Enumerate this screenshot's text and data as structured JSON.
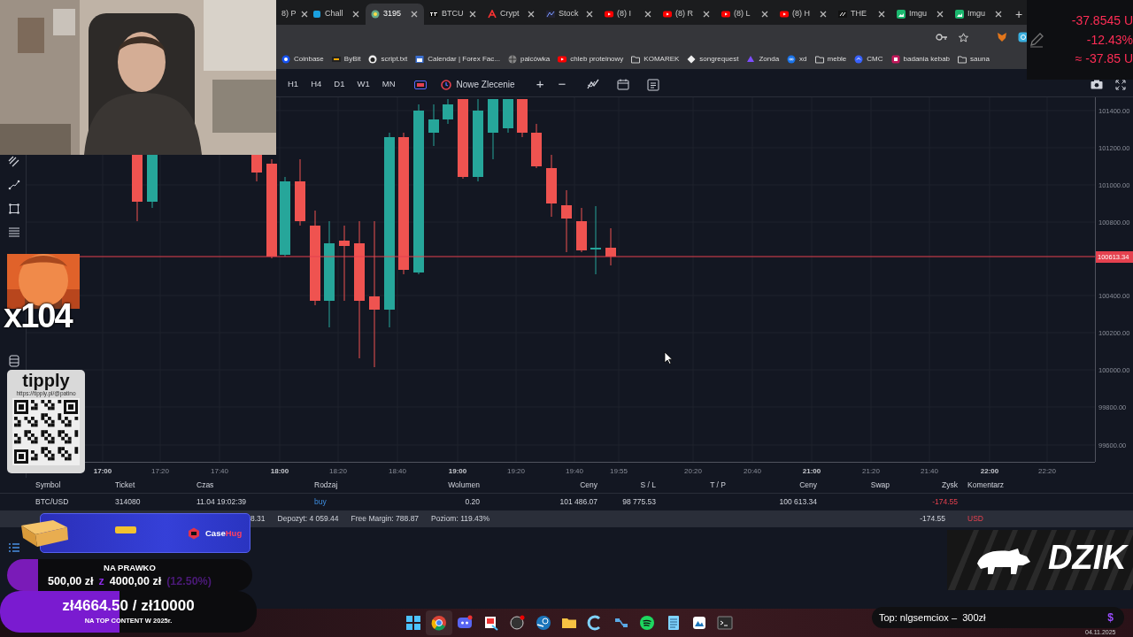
{
  "browser": {
    "tabs": [
      {
        "label": "8) P",
        "selected": false
      },
      {
        "label": "Chall",
        "selected": false
      },
      {
        "label": "3195",
        "selected": true
      },
      {
        "label": "BTCU",
        "selected": false
      },
      {
        "label": "Crypt",
        "selected": false
      },
      {
        "label": "Stock",
        "selected": false
      },
      {
        "label": "(8) I",
        "selected": false
      },
      {
        "label": "(8) R",
        "selected": false
      },
      {
        "label": "(8) L",
        "selected": false
      },
      {
        "label": "(8) H",
        "selected": false
      },
      {
        "label": "THE",
        "selected": false
      },
      {
        "label": "Imgu",
        "selected": false
      },
      {
        "label": "Imgu",
        "selected": false
      }
    ],
    "new_tab": "+",
    "bookmarks": [
      {
        "label": "Coinbase"
      },
      {
        "label": "ByBit"
      },
      {
        "label": "script.txt"
      },
      {
        "label": "Calendar | Forex Fac..."
      },
      {
        "label": "palcówka"
      },
      {
        "label": "chleb proteinowy"
      },
      {
        "label": "KOMAREK"
      },
      {
        "label": "songrequest"
      },
      {
        "label": "Zonda"
      },
      {
        "label": "xd"
      },
      {
        "label": "meble"
      },
      {
        "label": "CMC"
      },
      {
        "label": "badania kebab"
      },
      {
        "label": "sauna"
      }
    ]
  },
  "pnl_overlay": {
    "lines": [
      "-37.8545 U",
      "-12.43%",
      "≈ -37.85 U"
    ]
  },
  "toolbar": {
    "timeframes": [
      "H1",
      "H4",
      "D1",
      "W1",
      "MN"
    ],
    "new_order": "Nowe Zlecenie",
    "zoom_in": "+",
    "zoom_out": "−"
  },
  "chart": {
    "price_labels": [
      "101400.00",
      "101200.00",
      "101000.00",
      "100800.00",
      "100400.00",
      "100200.00",
      "100000.00",
      "99800.00",
      "99600.00"
    ],
    "current_price": "100613.34",
    "time_labels": [
      {
        "label": "17:00",
        "major": true
      },
      {
        "label": "17:20",
        "major": false
      },
      {
        "label": "17:40",
        "major": false
      },
      {
        "label": "18:00",
        "major": true
      },
      {
        "label": "18:20",
        "major": false
      },
      {
        "label": "18:40",
        "major": false
      },
      {
        "label": "19:00",
        "major": true
      },
      {
        "label": "19:20",
        "major": false
      },
      {
        "label": "19:40",
        "major": false
      },
      {
        "label": "19:55",
        "major": false
      },
      {
        "label": "20:20",
        "major": false
      },
      {
        "label": "20:40",
        "major": false
      },
      {
        "label": "21:00",
        "major": true
      },
      {
        "label": "21:20",
        "major": false
      },
      {
        "label": "21:40",
        "major": false
      },
      {
        "label": "22:00",
        "major": true
      },
      {
        "label": "22:20",
        "major": false
      }
    ]
  },
  "table": {
    "columns": [
      "Symbol",
      "Ticket",
      "Czas",
      "Rodzaj",
      "Wolumen",
      "Ceny",
      "S / L",
      "T / P",
      "Ceny",
      "Swap",
      "Zysk",
      "Komentarz"
    ],
    "rows": [
      {
        "symbol": "BTC/USD",
        "ticket": "314080",
        "time": "11.04 19:02:39",
        "type": "buy",
        "volume": "0.20",
        "open_price": "101 486.07",
        "sl": "98 775.53",
        "price": "100 613.34",
        "profit": "-174.55",
        "profit_negative": true
      }
    ],
    "summary": {
      "balance_tail": "8.31",
      "deposit": "Depozyt: 4 059.44",
      "free_margin": "Free Margin: 788.87",
      "margin_level": "Poziom: 119.43%",
      "profit": "-174.55",
      "currency": "USD"
    }
  },
  "emote": {
    "kind": "picture",
    "count": "x104"
  },
  "tipply": {
    "brand": "tipply",
    "url": "https://tipply.pl/@patino"
  },
  "sponsor_banner": {
    "brand": "Case",
    "brand_accent": "Hug"
  },
  "goal": {
    "title": "NA PRAWKO",
    "current": "500,00 zł",
    "separator": "z",
    "target": "4000,00 zł",
    "percent": "(12.50%)",
    "level": 0.125
  },
  "top_goal": {
    "amount": "zł4664.50 / zł10000",
    "caption": "NA TOP CONTENT W 2025r.",
    "level": 0.466
  },
  "dzik_logo": {
    "text": "DZIK"
  },
  "top_donor": {
    "text": "Top: nlgsemciox –  300zł",
    "symbol": "$"
  },
  "taskbar": {
    "date": "04.11.2025"
  }
}
